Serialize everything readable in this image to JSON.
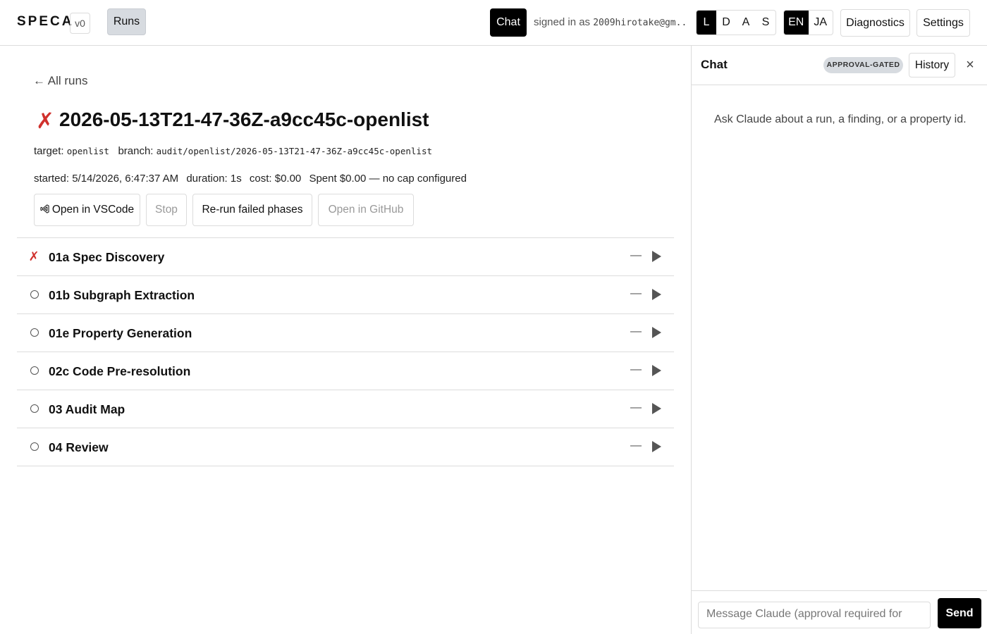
{
  "header": {
    "brand": "SPECA",
    "version": "v0",
    "runs_tab": "Runs",
    "chat_toggle": "Chat",
    "signed_in_prefix": "signed in as",
    "signed_in_email": "2009hirotake@gm...",
    "dash_options": [
      "L",
      "D",
      "A",
      "S"
    ],
    "dash_active": "L",
    "lang_options": [
      "EN",
      "JA"
    ],
    "lang_active": "EN",
    "diagnostics": "Diagnostics",
    "settings": "Settings"
  },
  "run": {
    "back": "← All runs",
    "status_icon": "✗",
    "title": "2026-05-13T21-47-36Z-a9cc45c-openlist",
    "target_label": "target:",
    "target": "openlist",
    "branch_label": "branch:",
    "branch": "audit/openlist/2026-05-13T21-47-36Z-a9cc45c-openlist",
    "started": "started: 5/14/2026, 6:47:37 AM",
    "duration": "duration: 1s",
    "cost": "cost: $0.00",
    "budget": "Spent $0.00 — no cap configured",
    "actions": {
      "vscode": "Open in VSCode",
      "stop": "Stop",
      "rerun": "Re-run failed phases",
      "github": "Open in GitHub"
    }
  },
  "phases": [
    {
      "status": "failed",
      "icon": "✗",
      "name": "01a Spec Discovery",
      "cost": "—"
    },
    {
      "status": "pending",
      "icon": "",
      "name": "01b Subgraph Extraction",
      "cost": "—"
    },
    {
      "status": "pending",
      "icon": "",
      "name": "01e Property Generation",
      "cost": "—"
    },
    {
      "status": "pending",
      "icon": "",
      "name": "02c Code Pre-resolution",
      "cost": "—"
    },
    {
      "status": "pending",
      "icon": "",
      "name": "03 Audit Map",
      "cost": "—"
    },
    {
      "status": "pending",
      "icon": "",
      "name": "04 Review",
      "cost": "—"
    }
  ],
  "chat": {
    "title": "Chat",
    "badge": "APPROVAL-GATED",
    "history": "History",
    "close": "×",
    "empty": "Ask Claude about a run, a finding, or a property id.",
    "placeholder": "Message Claude (approval required for",
    "send": "Send"
  },
  "colors": {
    "accent": "#000000",
    "fail": "#d0312d",
    "border": "#dcdcdc",
    "chip": "#d7dbe0"
  }
}
